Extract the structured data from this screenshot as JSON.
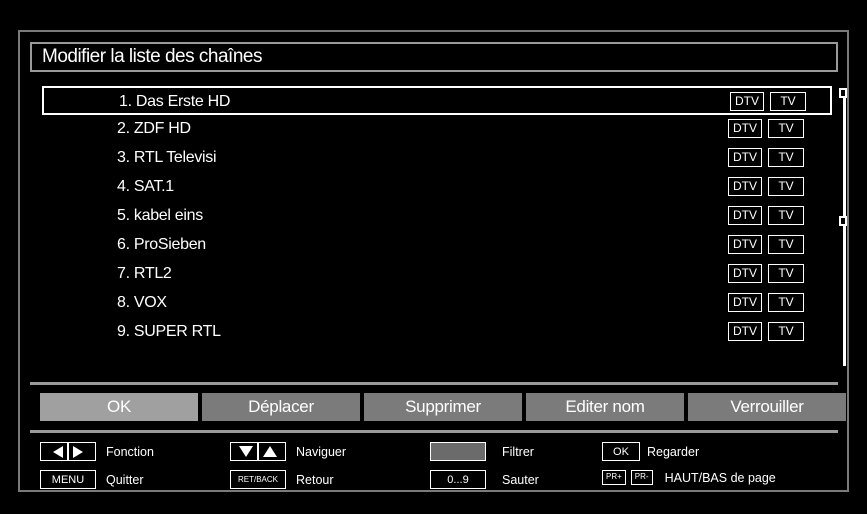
{
  "title": "Modifier la liste des chaînes",
  "channels": [
    {
      "label": "1. Das Erste HD",
      "dtv": "DTV",
      "tv": "TV",
      "selected": true
    },
    {
      "label": "2. ZDF HD",
      "dtv": "DTV",
      "tv": "TV"
    },
    {
      "label": "3. RTL Televisi",
      "dtv": "DTV",
      "tv": "TV"
    },
    {
      "label": "4. SAT.1",
      "dtv": "DTV",
      "tv": "TV"
    },
    {
      "label": "5. kabel eins",
      "dtv": "DTV",
      "tv": "TV"
    },
    {
      "label": "6. ProSieben",
      "dtv": "DTV",
      "tv": "TV"
    },
    {
      "label": "7. RTL2",
      "dtv": "DTV",
      "tv": "TV"
    },
    {
      "label": "8. VOX",
      "dtv": "DTV",
      "tv": "TV"
    },
    {
      "label": "9. SUPER RTL",
      "dtv": "DTV",
      "tv": "TV"
    }
  ],
  "actions": {
    "ok": "OK",
    "move": "Déplacer",
    "delete": "Supprimer",
    "edit_name": "Editer nom",
    "lock": "Verrouiller"
  },
  "help": {
    "function": "Fonction",
    "menu_key": "MENU",
    "quit": "Quitter",
    "navigate": "Naviguer",
    "ret_key": "RET/BACK",
    "return": "Retour",
    "filter": "Filtrer",
    "digits_key": "0...9",
    "jump": "Sauter",
    "ok_key": "OK",
    "watch": "Regarder",
    "pr_plus": "PR+",
    "pr_minus": "PR-",
    "page": "HAUT/BAS de page"
  },
  "colors": {
    "background": "#000000",
    "button": "#7b7b7b",
    "button_active": "#a0a0a0",
    "frame": "#7a7a7a"
  }
}
